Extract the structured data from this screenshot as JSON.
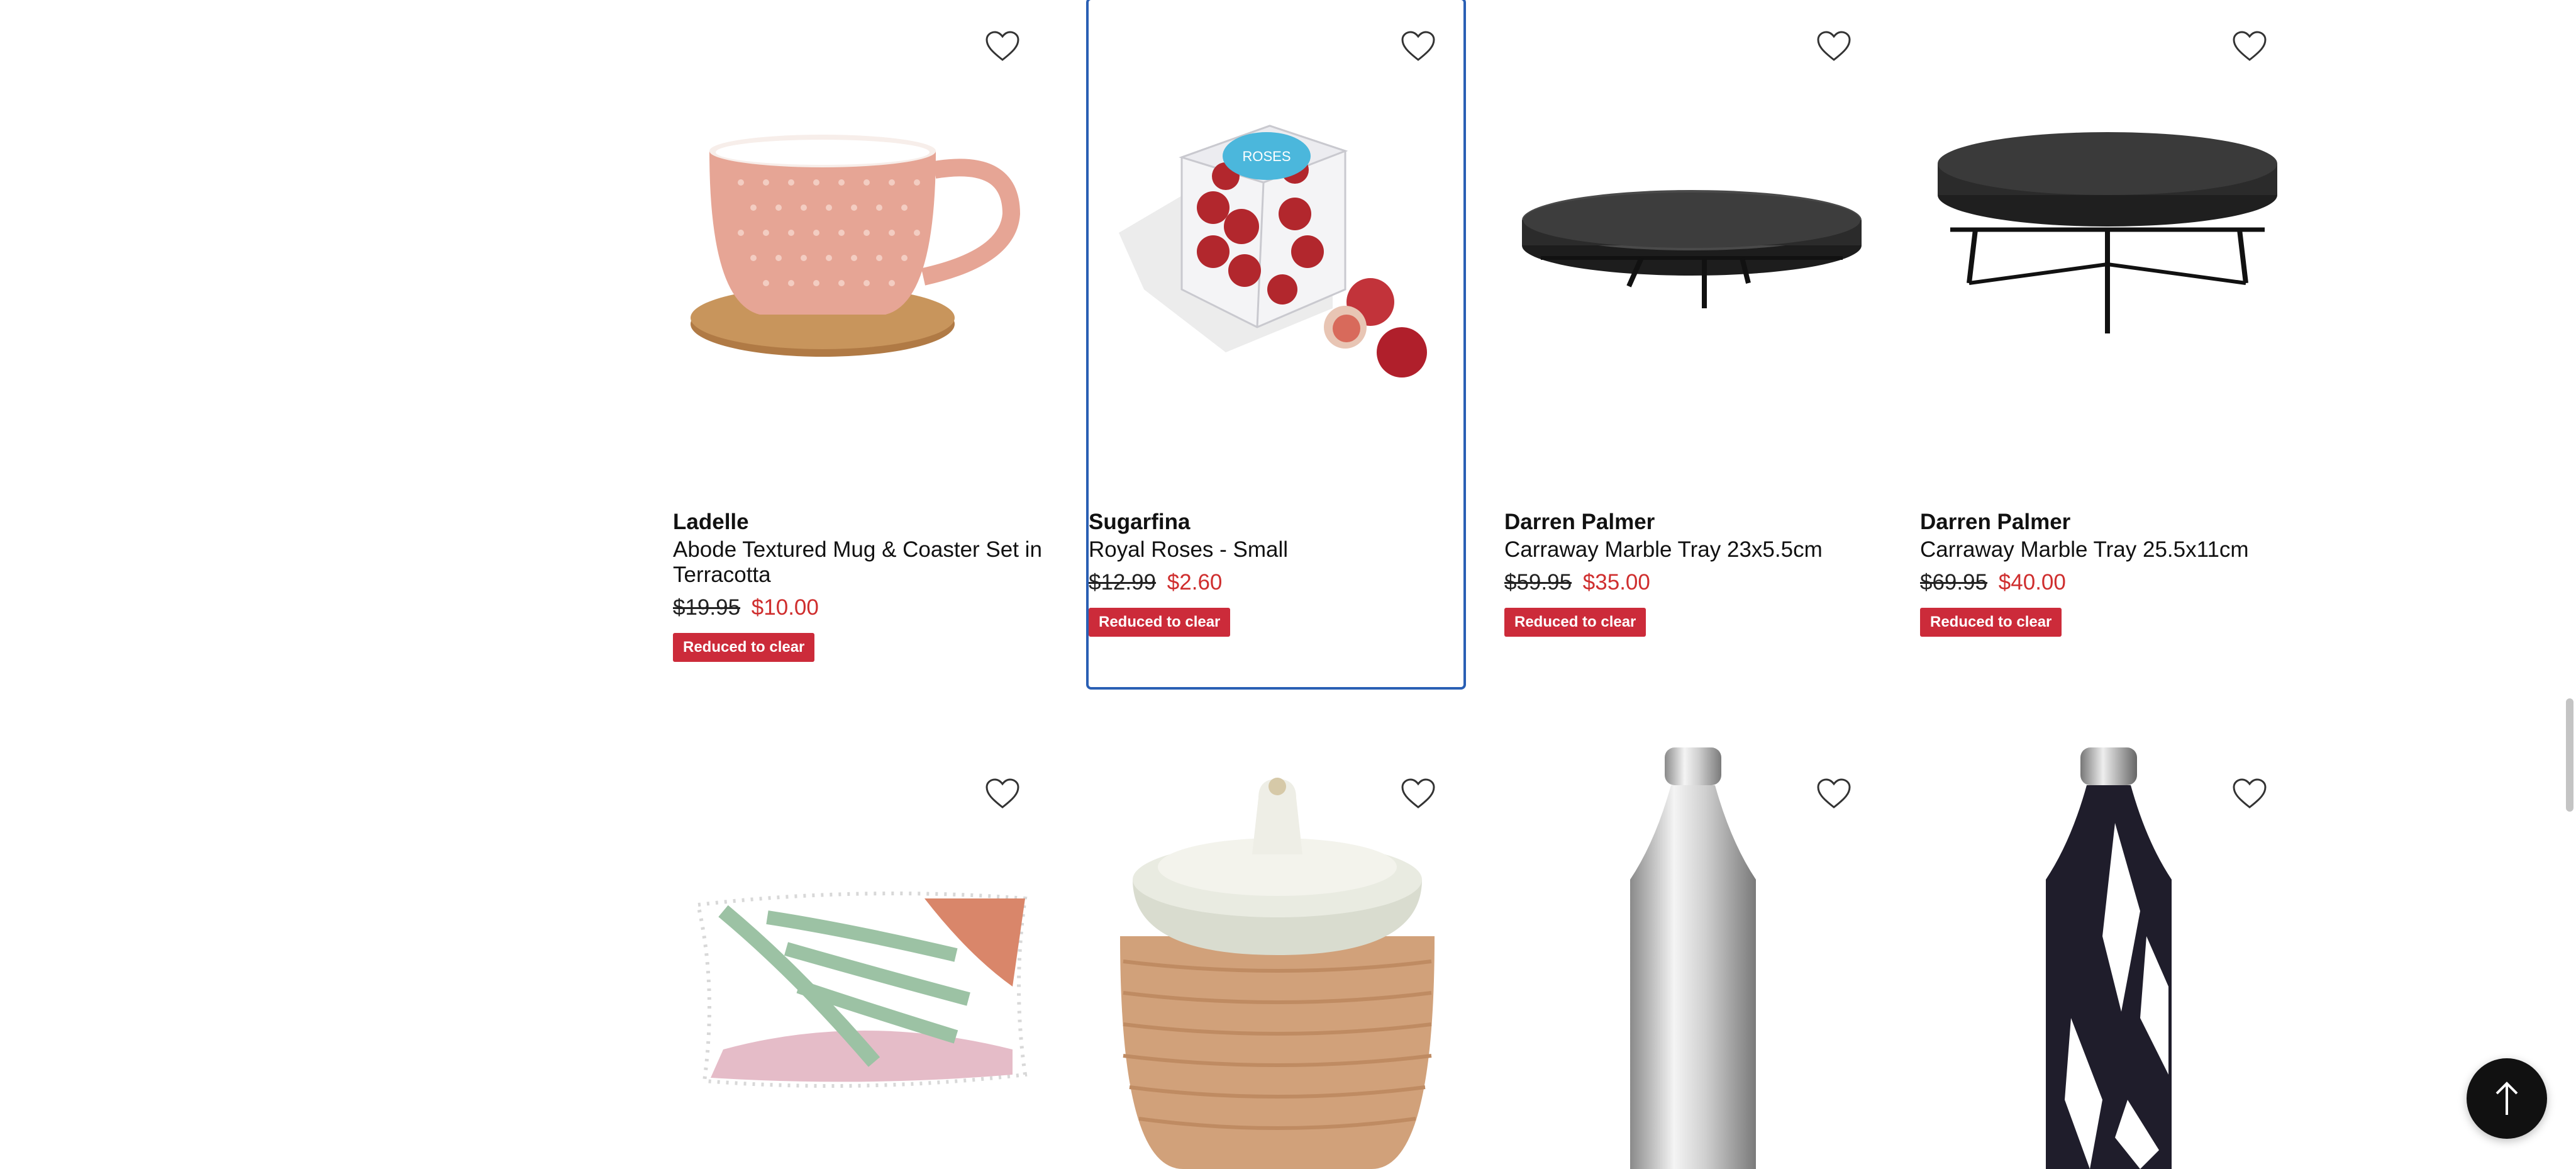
{
  "colors": {
    "sale_price": "#cf2e2e",
    "badge_bg": "#cc2b3a",
    "focus_outline": "#2a5fb4"
  },
  "products": [
    {
      "brand": "Ladelle",
      "name": "Abode Textured Mug & Coaster Set in Terracotta",
      "was_price": "$19.95",
      "now_price": "$10.00",
      "badge": "Reduced to clear",
      "image": "pink-mug-on-cork-coaster"
    },
    {
      "brand": "Sugarfina",
      "name": "Royal Roses - Small",
      "was_price": "$12.99",
      "now_price": "$2.60",
      "badge": "Reduced to clear",
      "image": "candy-cube-box"
    },
    {
      "brand": "Darren Palmer",
      "name": "Carraway Marble Tray 23x5.5cm",
      "was_price": "$59.95",
      "now_price": "$35.00",
      "badge": "Reduced to clear",
      "image": "low-black-marble-tray"
    },
    {
      "brand": "Darren Palmer",
      "name": "Carraway Marble Tray 25.5x11cm",
      "was_price": "$69.95",
      "now_price": "$40.00",
      "badge": "Reduced to clear",
      "image": "tall-black-marble-tray"
    },
    {
      "image": "leaf-print-cushion"
    },
    {
      "image": "ceramic-canister"
    },
    {
      "image": "silver-water-bottle"
    },
    {
      "image": "black-white-water-bottle"
    }
  ],
  "wishlist_icon": "heart-outline-icon",
  "back_to_top_icon": "arrow-up-icon"
}
